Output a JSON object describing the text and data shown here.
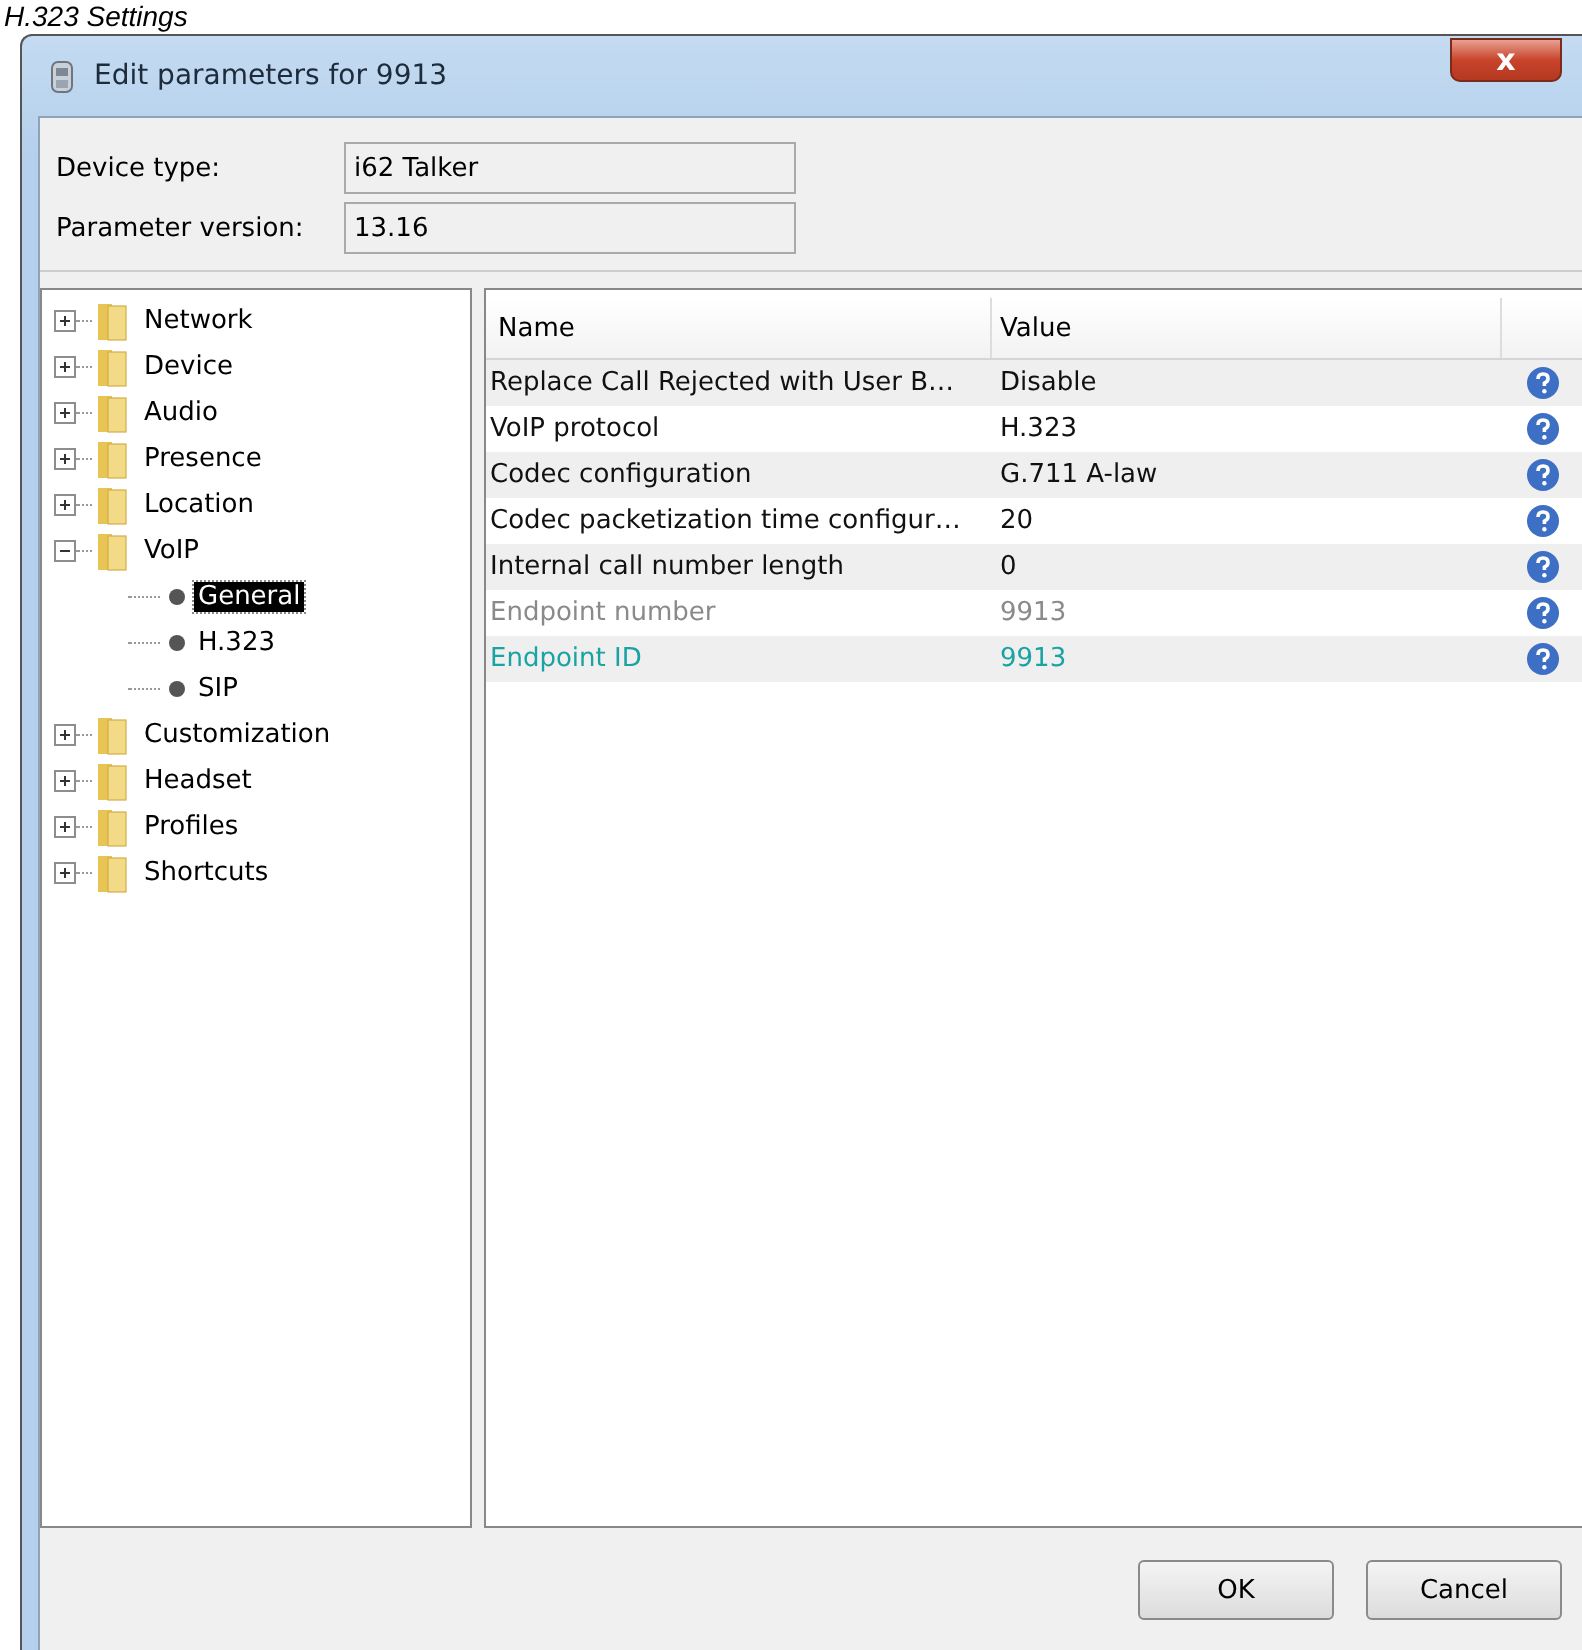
{
  "caption": "H.323 Settings",
  "window": {
    "title": "Edit parameters for 9913",
    "close": "x"
  },
  "info": [
    {
      "label": "Device type:",
      "value": "i62 Talker"
    },
    {
      "label": "Parameter version:",
      "value": "13.16"
    }
  ],
  "tree": [
    {
      "label": "Network",
      "expanded": false,
      "selected": false
    },
    {
      "label": "Device",
      "expanded": false,
      "selected": false
    },
    {
      "label": "Audio",
      "expanded": false,
      "selected": false
    },
    {
      "label": "Presence",
      "expanded": false,
      "selected": false
    },
    {
      "label": "Location",
      "expanded": false,
      "selected": false
    },
    {
      "label": "VoIP",
      "expanded": true,
      "selected": false,
      "children": [
        {
          "label": "General",
          "selected": true
        },
        {
          "label": "H.323",
          "selected": false
        },
        {
          "label": "SIP",
          "selected": false
        }
      ]
    },
    {
      "label": "Customization",
      "expanded": false,
      "selected": false
    },
    {
      "label": "Headset",
      "expanded": false,
      "selected": false
    },
    {
      "label": "Profiles",
      "expanded": false,
      "selected": false
    },
    {
      "label": "Shortcuts",
      "expanded": false,
      "selected": false
    }
  ],
  "table": {
    "columns": [
      "Name",
      "Value"
    ],
    "rows": [
      {
        "name": "Replace Call Rejected with User B…",
        "value": "Disable",
        "kind": "normal"
      },
      {
        "name": "VoIP protocol",
        "value": "H.323",
        "kind": "normal"
      },
      {
        "name": "Codec configuration",
        "value": "G.711 A-law",
        "kind": "normal"
      },
      {
        "name": "Codec packetization time configur…",
        "value": "20",
        "kind": "normal"
      },
      {
        "name": "Internal call number length",
        "value": "0",
        "kind": "normal"
      },
      {
        "name": "Endpoint number",
        "value": "9913",
        "kind": "readonly"
      },
      {
        "name": "Endpoint ID",
        "value": "9913",
        "kind": "changed"
      }
    ]
  },
  "buttons": [
    "OK",
    "Cancel"
  ]
}
